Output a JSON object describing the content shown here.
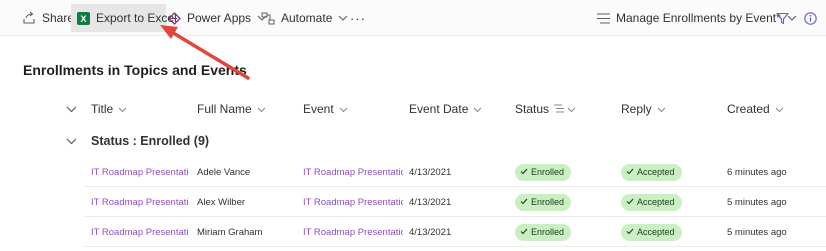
{
  "commandbar": {
    "share": "Share",
    "export": "Export to Excel",
    "powerapps": "Power Apps",
    "automate": "Automate",
    "more": "···",
    "view": "Manage Enrollments by Event*"
  },
  "list_title": "Enrollments in Topics and Events",
  "columns": {
    "title": "Title",
    "fullname": "Full Name",
    "event": "Event",
    "eventdate": "Event Date",
    "status": "Status",
    "reply": "Reply",
    "created": "Created"
  },
  "group": {
    "label": "Status : Enrolled (9)"
  },
  "rows": [
    {
      "title": "IT Roadmap Presentation",
      "fullname": "Adele Vance",
      "event": "IT Roadmap Presentation",
      "eventdate": "4/13/2021",
      "status": "Enrolled",
      "reply": "Accepted",
      "created": "6 minutes ago"
    },
    {
      "title": "IT Roadmap Presentation",
      "fullname": "Alex Wilber",
      "event": "IT Roadmap Presentation",
      "eventdate": "4/13/2021",
      "status": "Enrolled",
      "reply": "Accepted",
      "created": "5 minutes ago"
    },
    {
      "title": "IT Roadmap Presentation",
      "fullname": "Miriam Graham",
      "event": "IT Roadmap Presentation",
      "eventdate": "4/13/2021",
      "status": "Enrolled",
      "reply": "Accepted",
      "created": "5 minutes ago"
    }
  ],
  "colors": {
    "accent": "#8e4fc6",
    "badge_bg": "#c9efc2",
    "annotation_arrow": "#e0463a",
    "excel_green": "#107c41"
  }
}
